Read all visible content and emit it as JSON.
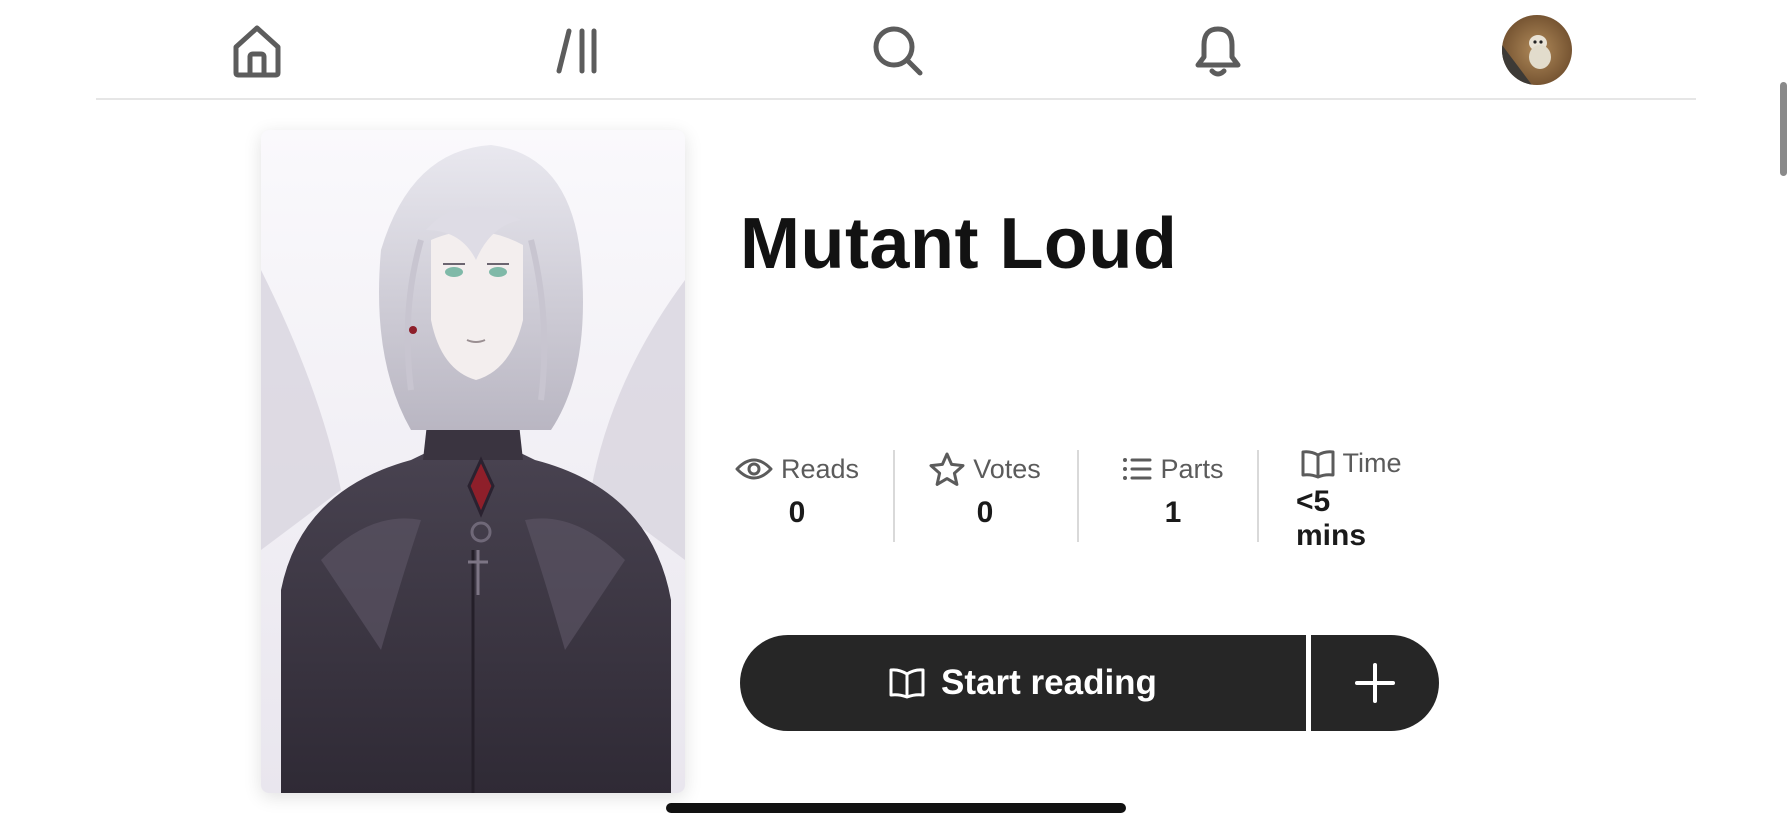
{
  "nav": {
    "items": [
      {
        "name": "home",
        "icon": "home-icon"
      },
      {
        "name": "library",
        "icon": "library-icon"
      },
      {
        "name": "search",
        "icon": "search-icon"
      },
      {
        "name": "notifications",
        "icon": "bell-icon"
      },
      {
        "name": "profile",
        "icon": "avatar"
      }
    ]
  },
  "story": {
    "title": "Mutant Loud",
    "stats": {
      "reads": {
        "label": "Reads",
        "value": "0",
        "icon": "eye-icon"
      },
      "votes": {
        "label": "Votes",
        "value": "0",
        "icon": "star-icon"
      },
      "parts": {
        "label": "Parts",
        "value": "1",
        "icon": "list-icon"
      },
      "time": {
        "label": "Time",
        "value": "<5 mins",
        "icon": "book-icon"
      }
    }
  },
  "actions": {
    "start_reading_label": "Start reading",
    "add_icon": "plus-icon"
  },
  "colors": {
    "button_bg": "#262626",
    "text_primary": "#121212",
    "text_secondary": "#5b5b5b",
    "divider": "#d9d9d9"
  }
}
